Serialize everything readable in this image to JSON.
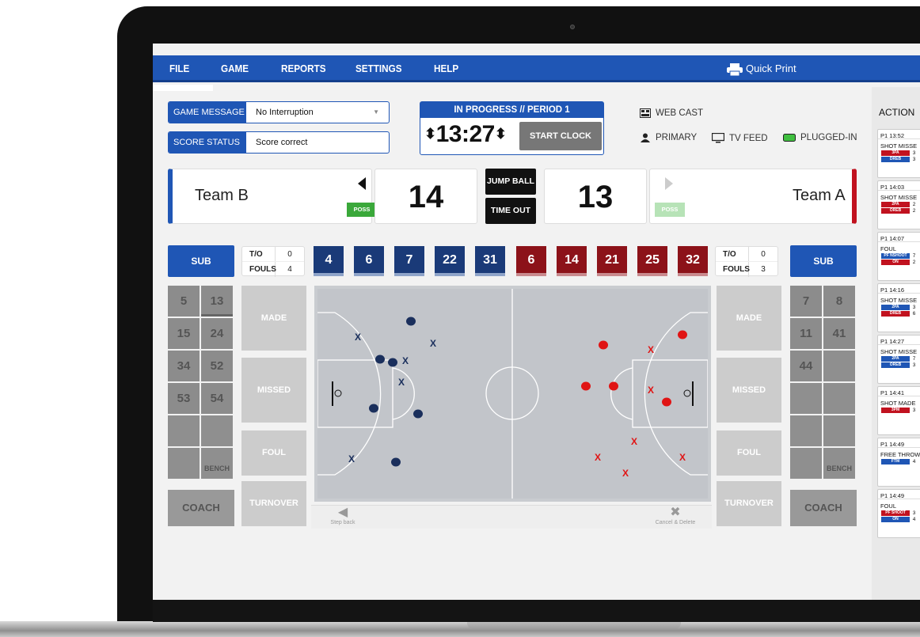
{
  "menu": {
    "file": "FILE",
    "game": "GAME",
    "reports": "REPORTS",
    "settings": "SETTINGS",
    "help": "HELP",
    "quick_print": "Quick Print"
  },
  "game_message": {
    "label": "GAME MESSAGE",
    "value": "No Interruption"
  },
  "score_status": {
    "label": "SCORE STATUS",
    "value": "Score correct"
  },
  "clock": {
    "status": "IN PROGRESS  //  PERIOD 1",
    "time": "13:27",
    "start_label": "START CLOCK"
  },
  "broadcast": {
    "webcast": "WEB CAST",
    "primary": "PRIMARY",
    "tv_feed": "TV FEED",
    "plugged_in": "PLUGGED-IN",
    "plugged_color": "#3fbf3f"
  },
  "team_left": {
    "name": "Team B",
    "score": "14",
    "poss": "POSS",
    "color": "#1f56b5"
  },
  "team_right": {
    "name": "Team A",
    "score": "13",
    "poss": "POSS",
    "color": "#c1121f"
  },
  "center": {
    "jump_ball": "JUMP BALL",
    "time_out": "TIME OUT"
  },
  "left_stats": {
    "to_label": "T/O",
    "to": "0",
    "fouls_label": "FOULS",
    "fouls": "4"
  },
  "right_stats": {
    "to_label": "T/O",
    "to": "0",
    "fouls_label": "FOULS",
    "fouls": "3"
  },
  "sub_label": "SUB",
  "left_oncourt": [
    "4",
    "6",
    "7",
    "22",
    "31"
  ],
  "right_oncourt": [
    "6",
    "14",
    "21",
    "25",
    "32"
  ],
  "left_bench": [
    "5",
    "13",
    "15",
    "24",
    "34",
    "52",
    "53",
    "54"
  ],
  "right_bench": [
    "7",
    "8",
    "11",
    "41",
    "44"
  ],
  "bench_label": "BENCH",
  "coach_label": "COACH",
  "actions": {
    "made": "MADE",
    "missed": "MISSED",
    "foul": "FOUL",
    "turnover": "TURNOVER"
  },
  "court_nav": {
    "step_back": "Step back",
    "cancel": "Cancel & Delete"
  },
  "shot_marks": {
    "made": "●",
    "missed": "X"
  },
  "action_log": {
    "title": "ACTION",
    "events": [
      {
        "time": "P1  13:52",
        "desc": "SHOT MISSE",
        "tags": [
          {
            "t": "3PA",
            "c": "r",
            "n": "3"
          },
          {
            "t": "DREB",
            "c": "b",
            "n": "3"
          }
        ]
      },
      {
        "time": "P1  14:03",
        "desc": "SHOT MISSE",
        "tags": [
          {
            "t": "2PA",
            "c": "r",
            "n": "2"
          },
          {
            "t": "OREB",
            "c": "r",
            "n": "2"
          }
        ]
      },
      {
        "time": "P1  14:07",
        "desc": "FOUL",
        "tags": [
          {
            "t": "PF NSHOOT",
            "c": "b",
            "n": "7"
          },
          {
            "t": "ON",
            "c": "r",
            "n": "2"
          }
        ]
      },
      {
        "time": "P1  14:16",
        "desc": "SHOT MISSE",
        "tags": [
          {
            "t": "2PA",
            "c": "b",
            "n": "3"
          },
          {
            "t": "DREB",
            "c": "r",
            "n": "6"
          }
        ]
      },
      {
        "time": "P1  14:27",
        "desc": "SHOT MISSE",
        "tags": [
          {
            "t": "2PA",
            "c": "b",
            "n": "7"
          },
          {
            "t": "OREB",
            "c": "b",
            "n": "3"
          }
        ]
      },
      {
        "time": "P1  14:41",
        "desc": "SHOT MADE",
        "tags": [
          {
            "t": "3PM",
            "c": "r",
            "n": "3"
          }
        ]
      },
      {
        "time": "P1  14:49",
        "desc": "FREE THROW",
        "tags": [
          {
            "t": "FTM",
            "c": "b",
            "n": "4"
          }
        ]
      },
      {
        "time": "P1  14:49",
        "desc": "FOUL",
        "tags": [
          {
            "t": "PF SHOOT",
            "c": "r",
            "n": "3"
          },
          {
            "t": "ON",
            "c": "b",
            "n": "4"
          }
        ]
      }
    ]
  }
}
